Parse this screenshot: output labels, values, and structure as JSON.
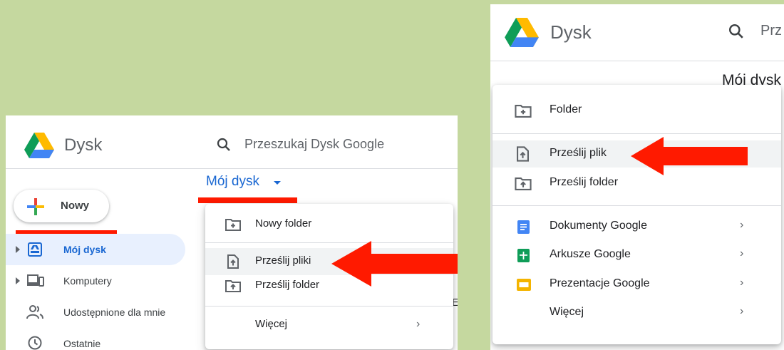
{
  "app": {
    "title": "Dysk"
  },
  "left": {
    "search_placeholder": "Przeszukaj Dysk Google",
    "new_button": "Nowy",
    "breadcrumb": "Mój dysk",
    "nav": [
      {
        "label": "Mój dysk",
        "icon": "drive-icon",
        "active": true
      },
      {
        "label": "Komputery",
        "icon": "computers-icon"
      },
      {
        "label": "Udostępnione dla mnie",
        "icon": "shared-icon"
      },
      {
        "label": "Ostatnie",
        "icon": "recent-icon"
      }
    ],
    "menu": [
      {
        "label": "Nowy folder",
        "icon": "new-folder-icon"
      },
      {
        "label": "Prześlij pliki",
        "icon": "upload-file-icon"
      },
      {
        "label": "Prześlij folder",
        "icon": "upload-folder-icon"
      },
      {
        "label": "Więcej"
      }
    ]
  },
  "right": {
    "search_partial": "Prz",
    "heading_partial": "Mój dysk",
    "menu": [
      {
        "label": "Folder",
        "icon": "new-folder-icon"
      },
      {
        "label": "Prześlij plik",
        "icon": "upload-file-icon"
      },
      {
        "label": "Prześlij folder",
        "icon": "upload-folder-icon"
      },
      {
        "label": "Dokumenty Google",
        "icon": "docs-icon"
      },
      {
        "label": "Arkusze Google",
        "icon": "sheets-icon"
      },
      {
        "label": "Prezentacje Google",
        "icon": "slides-icon"
      },
      {
        "label": "Więcej"
      }
    ]
  },
  "colors": {
    "accent_blue": "#1967d2",
    "highlight_red": "#ff1a00",
    "background": "#c5d89f",
    "docs_blue": "#4285f4",
    "sheets_green": "#0f9d58",
    "slides_yellow": "#f4b400"
  }
}
